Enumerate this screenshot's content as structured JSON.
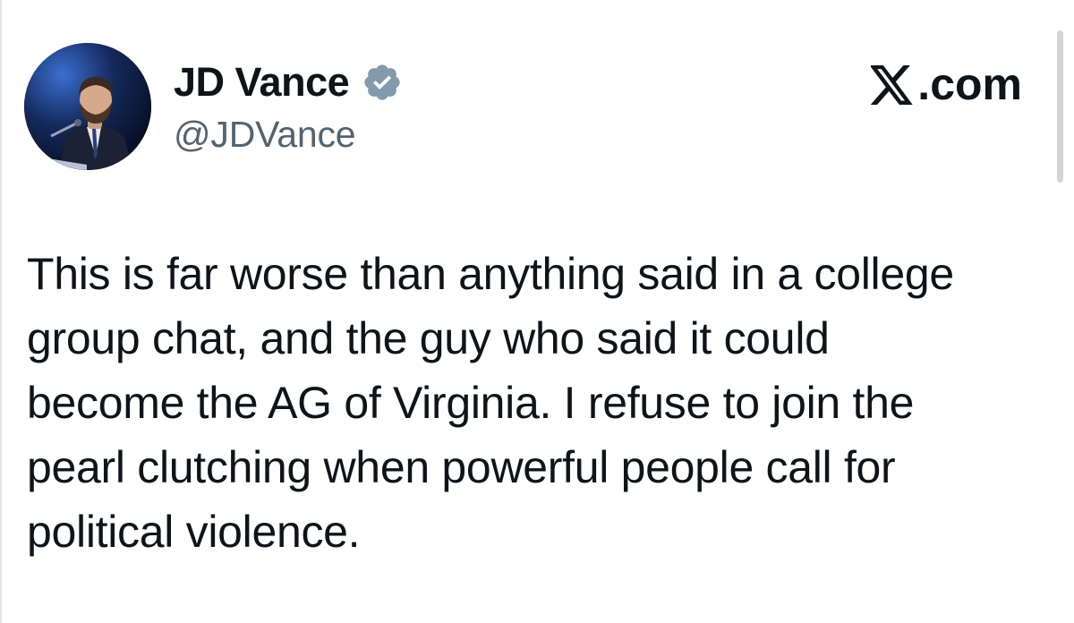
{
  "post": {
    "author": {
      "display_name": "JD Vance",
      "handle": "@JDVance",
      "verified": true,
      "avatar_icon": "profile-photo"
    },
    "brand": {
      "text": ".com",
      "icon": "x-logo-icon"
    },
    "text": "This is far worse than anything said in a college\ngroup chat, and the guy who said it could\nbecome the AG of Virginia. I refuse to join the\npearl clutching when powerful people call for\npolitical violence."
  },
  "colors": {
    "text": "#0f1419",
    "secondary": "#536471",
    "verified_badge": "#829aab",
    "background": "#ffffff"
  }
}
